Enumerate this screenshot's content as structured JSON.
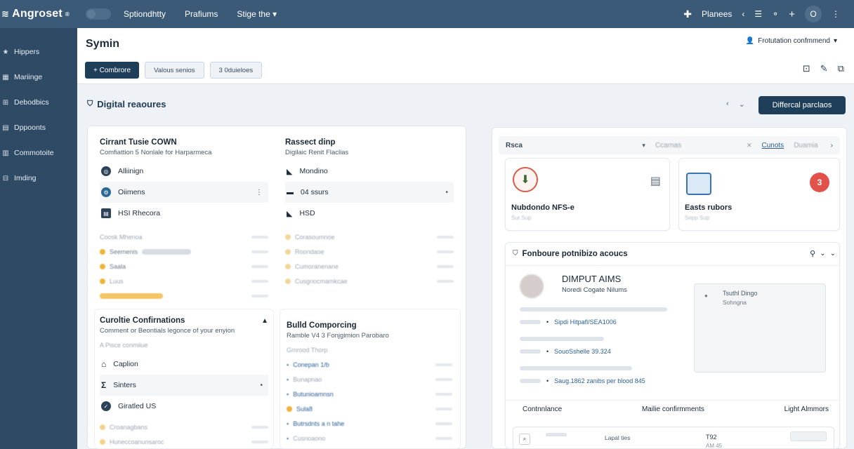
{
  "app": {
    "logo_text": "Angroset",
    "logo_mark": "®"
  },
  "topnav": {
    "items": [
      "Sptiondhtty",
      "Prafiums",
      "Stige the"
    ]
  },
  "top_right": {
    "label": "Planees"
  },
  "sidebar": {
    "items": [
      {
        "label": "Hippers",
        "icon": "★"
      },
      {
        "label": "Mariinge",
        "icon": "▦"
      },
      {
        "label": "Debodbics",
        "icon": "⊞"
      },
      {
        "label": "Dppoonts",
        "icon": "▤"
      },
      {
        "label": "Commotoite",
        "icon": "▥"
      },
      {
        "label": "Imding",
        "icon": "⊟"
      }
    ]
  },
  "header": {
    "title": "Symin",
    "buttons": {
      "primary": "+ Combrore",
      "secondary1": "Valous senios",
      "secondary2": "3 0duieloes"
    },
    "status_link": "Frotutation confmmend"
  },
  "section": {
    "title": "Digital reaoures",
    "button": "Differcal parclaos"
  },
  "cards": {
    "card1": {
      "title": "Cirrant Tusie COWN",
      "subtitle": "Comfiattion 5 Nonlale for Harparmeca",
      "items": [
        "Alliinign",
        "Oiimens",
        "HSI Rhecora"
      ],
      "faint": [
        "Coosk Mhenoa",
        "Seemenis",
        "Saala",
        "Luus"
      ]
    },
    "card2": {
      "title": "Rassect dinp",
      "subtitle": "Digilaic Renit Flaclias",
      "items": [
        "Mondino",
        "04 ssurs",
        "HSD"
      ],
      "faint": [
        "Corasoumnoe",
        "Roondaoe",
        "Cumoranenane",
        "Cusgnocmamkcae"
      ]
    },
    "card3": {
      "title": "Curoltie Confirnations",
      "subtitle": "Comment or Beontials legonce of your enyion",
      "faint_top": "A Pisce conmiiue",
      "items": [
        "Caplion",
        "Sinters",
        "Giratled US"
      ],
      "faint": [
        "Croanagbans",
        "Huneccoanunsaroc"
      ]
    },
    "card4": {
      "title": "Bulld Comporcing",
      "subtitle": "Ramble V4 3 Fonjgimion Parobaro",
      "faint_top": "Gmrood Thorp",
      "links": [
        "Conepan 1/b",
        "Bunapnao",
        "Butunioamnsn",
        "Sula8",
        "Butrsdnts a n tahe",
        "Cusnoaono"
      ]
    }
  },
  "right_panel": {
    "tabs": {
      "left": "Rsca",
      "mid": "Ccarnas",
      "link": "Cunots",
      "last": "Duamia"
    },
    "subcards": [
      {
        "label": "Nubdondo NFS-e",
        "sub": "Sur.Sup"
      },
      {
        "label": "Easts rubors",
        "sub": "Sepp Sup"
      }
    ],
    "detail": {
      "title": "Fonboure potnibizo acoucs",
      "heading": "DIMPUT AIMS",
      "subheading": "Noredi Cogate Nilums",
      "box_title": "Tsuthl Dingo",
      "box_sub": "Sohngna",
      "links": [
        "Sipdi Hitpafl/SEA1006",
        "SouoSshelle 39.324",
        "Saug.1862 zanibs per blood 845"
      ],
      "columns": [
        "Contnnlance",
        "Mailie confirmments",
        "Light Almmors"
      ],
      "bottom_values": [
        "Lapal ties",
        "T92",
        "AM 45"
      ]
    }
  }
}
